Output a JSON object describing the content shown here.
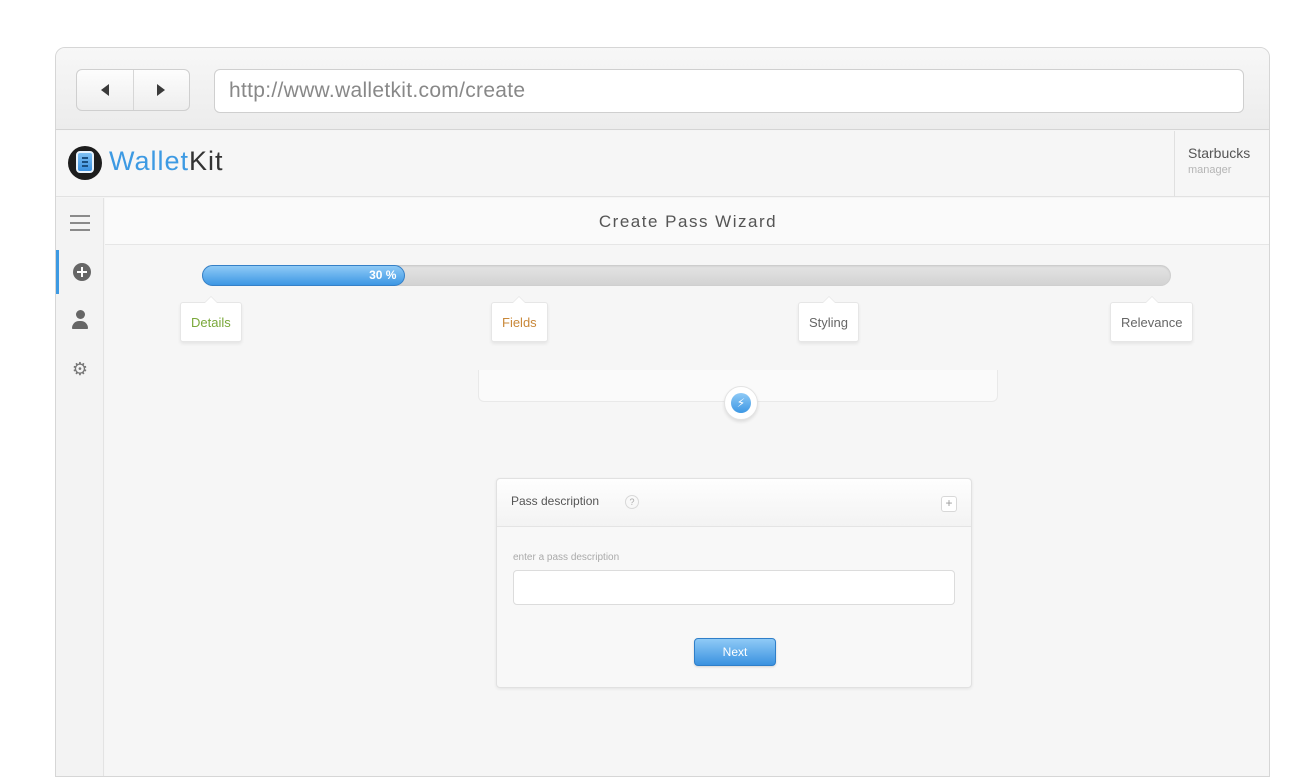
{
  "browser": {
    "url": "http://www.walletkit.com/create",
    "back_icon": "back-arrow-icon",
    "forward_icon": "forward-arrow-icon"
  },
  "app": {
    "brand_part1": "Wallet",
    "brand_part2": "Kit",
    "logo_icon": "wallet-phone-icon",
    "user_name": "Starbucks",
    "user_role": "manager",
    "accent_color": "#3d9ae3"
  },
  "sidebar": {
    "items": [
      {
        "icon": "menu-icon",
        "active": false
      },
      {
        "icon": "plus-circle-icon",
        "active": true
      },
      {
        "icon": "user-icon",
        "active": false
      },
      {
        "icon": "gear-icon",
        "active": false
      }
    ]
  },
  "wizard": {
    "title": "Create Pass Wizard",
    "progress_value": 0.3,
    "progress_label": "30 %",
    "steps": [
      {
        "label": "Details",
        "color": "#7aa83a"
      },
      {
        "label": "Fields",
        "color": "#c9883a"
      },
      {
        "label": "Styling",
        "color": "#666666"
      },
      {
        "label": "Relevance",
        "color": "#666666"
      }
    ],
    "bolt_icon": "lightning-icon"
  },
  "form": {
    "title": "Pass description",
    "help_label": "?",
    "add_label": "+",
    "field_label": "enter a pass description",
    "field_value": "",
    "next_label": "Next"
  }
}
